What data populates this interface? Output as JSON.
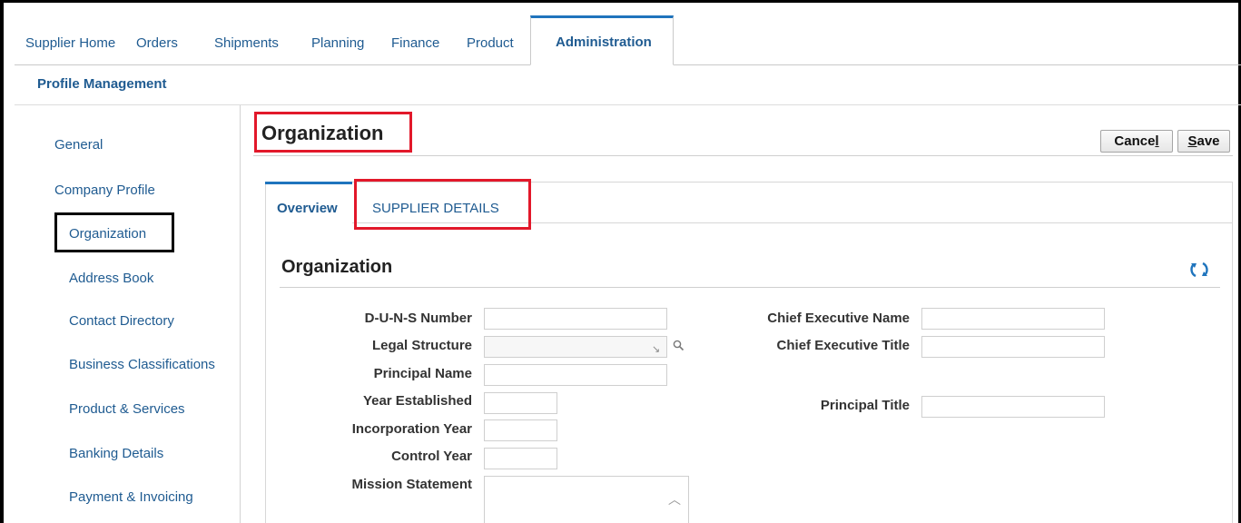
{
  "top_tabs": [
    {
      "label": "Supplier Home"
    },
    {
      "label": "Orders"
    },
    {
      "label": "Shipments"
    },
    {
      "label": "Planning"
    },
    {
      "label": "Finance"
    },
    {
      "label": "Product"
    },
    {
      "label": "Administration",
      "active": true
    }
  ],
  "subnav": {
    "label": "Profile Management"
  },
  "sidebar": {
    "items": [
      {
        "label": "General"
      },
      {
        "label": "Company Profile"
      },
      {
        "label": "Organization",
        "selected": true
      },
      {
        "label": "Address Book"
      },
      {
        "label": "Contact Directory"
      },
      {
        "label": "Business Classifications"
      },
      {
        "label": "Product & Services"
      },
      {
        "label": "Banking Details"
      },
      {
        "label": "Payment & Invoicing"
      }
    ]
  },
  "page": {
    "title": "Organization",
    "cancel_pre": "Cance",
    "cancel_ul": "l",
    "save_ul": "S",
    "save_post": "ave"
  },
  "subtabs": [
    {
      "label": "Overview",
      "active": true
    },
    {
      "label": "SUPPLIER DETAILS"
    }
  ],
  "section": {
    "title": "Organization"
  },
  "form": {
    "duns_label": "D-U-N-S Number",
    "duns_value": "",
    "legal_label": "Legal Structure",
    "legal_value": "",
    "principal_name_label": "Principal Name",
    "principal_name_value": "",
    "year_established_label": "Year Established",
    "year_established_value": "",
    "incorporation_year_label": "Incorporation Year",
    "incorporation_year_value": "",
    "control_year_label": "Control Year",
    "control_year_value": "",
    "mission_label": "Mission Statement",
    "mission_value": "",
    "ceo_name_label": "Chief Executive Name",
    "ceo_name_value": "",
    "ceo_title_label": "Chief Executive Title",
    "ceo_title_value": "",
    "principal_title_label": "Principal Title",
    "principal_title_value": ""
  },
  "colors": {
    "link": "#1f5b91",
    "accent_blue": "#1f74bd",
    "highlight_red": "#e2182a",
    "highlight_black": "#000000"
  },
  "icons": [
    "refresh-icon",
    "search-icon",
    "dropdown-corner-icon",
    "scroll-up-icon"
  ]
}
